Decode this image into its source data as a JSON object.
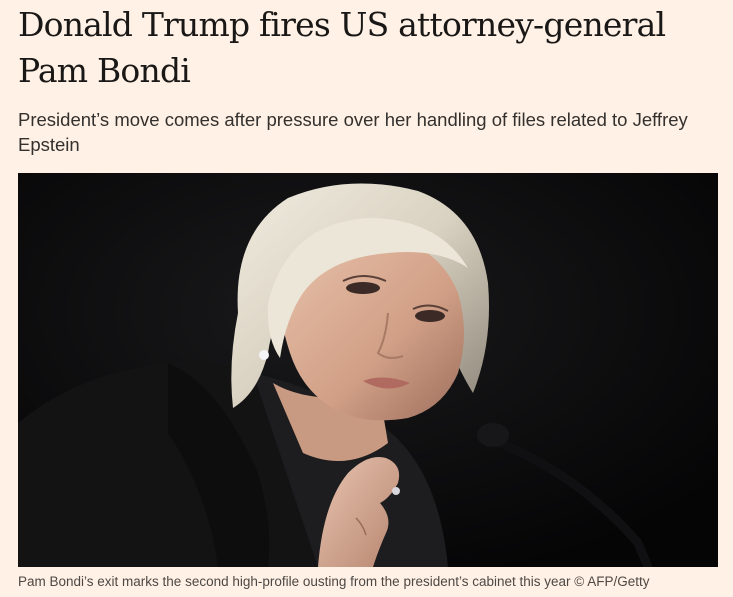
{
  "article": {
    "headline": "Donald Trump fires US attorney-general Pam Bondi",
    "standfirst": "President’s move comes after pressure over her handling of files related to Jeffrey Epstein",
    "image": {
      "caption": "Pam Bondi’s exit marks the second high-profile ousting from the president’s cabinet this year © AFP/Getty"
    }
  },
  "colors": {
    "page_background": "#FFF1E5",
    "headline_text": "#1A1817",
    "body_text": "#33302E",
    "caption_text": "#4D4845",
    "photo_background": "#0B0B0C"
  }
}
